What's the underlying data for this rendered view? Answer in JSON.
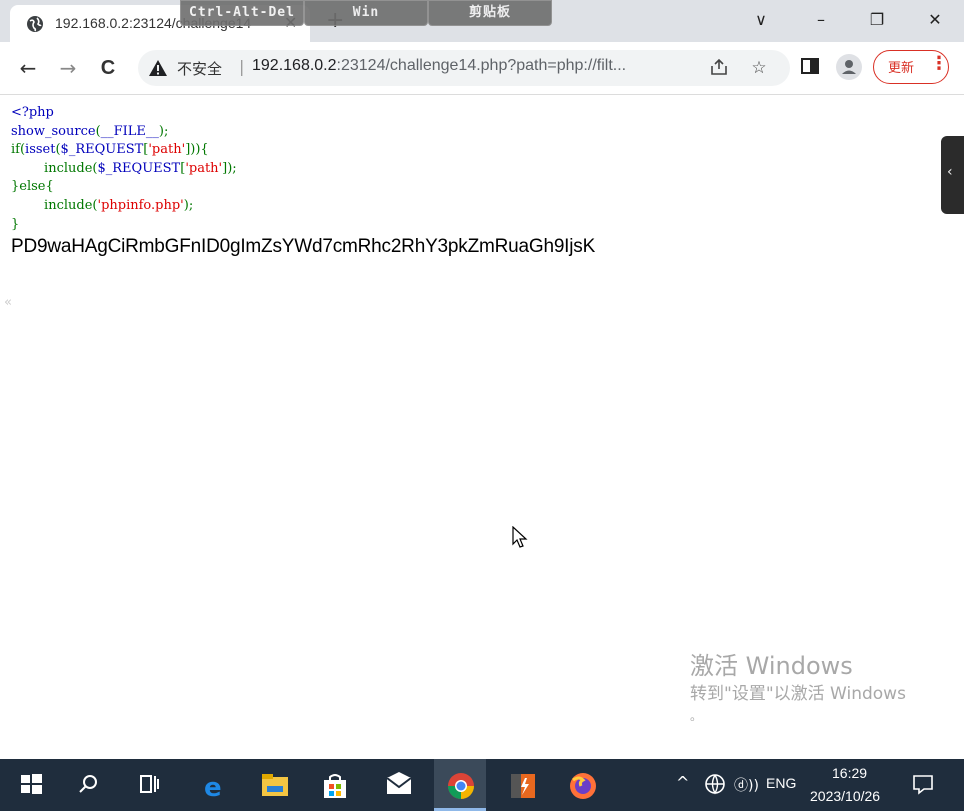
{
  "browser": {
    "tab_title": "192.168.0.2:23124/challenge14",
    "new_tab_symbol": "+",
    "window_controls": {
      "collapse": "∨",
      "minimize": "–",
      "restore": "❐",
      "close": "✕"
    },
    "remote_toolbar": {
      "ctrl_alt_del": "Ctrl-Alt-Del",
      "win": "Win",
      "clipboard": "剪贴板"
    },
    "nav": {
      "back": "←",
      "forward": "→",
      "reload": "C"
    },
    "address": {
      "security_label": "不安全",
      "separator": "|",
      "url_host": "192.168.0.2",
      "url_rest": ":23124/challenge14.php?path=php://filt..."
    },
    "update_button": "更新",
    "menu_symbol": "⋮"
  },
  "page": {
    "source_lines": [
      {
        "parts": [
          {
            "cls": "c-default",
            "text": "<?php"
          }
        ]
      },
      {
        "parts": [
          {
            "cls": "c-default",
            "text": "show_source"
          },
          {
            "cls": "c-keyword",
            "text": "("
          },
          {
            "cls": "c-default",
            "text": "__FILE__"
          },
          {
            "cls": "c-keyword",
            "text": ");"
          }
        ]
      },
      {
        "parts": [
          {
            "cls": "c-keyword",
            "text": "if("
          },
          {
            "cls": "c-default",
            "text": "isset"
          },
          {
            "cls": "c-keyword",
            "text": "("
          },
          {
            "cls": "c-default",
            "text": "$_REQUEST"
          },
          {
            "cls": "c-keyword",
            "text": "["
          },
          {
            "cls": "c-string",
            "text": "'path'"
          },
          {
            "cls": "c-keyword",
            "text": "])){"
          }
        ]
      },
      {
        "parts": [
          {
            "cls": "c-keyword",
            "text": "        include("
          },
          {
            "cls": "c-default",
            "text": "$_REQUEST"
          },
          {
            "cls": "c-keyword",
            "text": "["
          },
          {
            "cls": "c-string",
            "text": "'path'"
          },
          {
            "cls": "c-keyword",
            "text": "]);"
          }
        ]
      },
      {
        "parts": [
          {
            "cls": "c-keyword",
            "text": "}else{"
          }
        ]
      },
      {
        "parts": [
          {
            "cls": "c-keyword",
            "text": "        include("
          },
          {
            "cls": "c-string",
            "text": "'phpinfo.php'"
          },
          {
            "cls": "c-keyword",
            "text": ");"
          }
        ]
      },
      {
        "parts": [
          {
            "cls": "c-keyword",
            "text": "}"
          }
        ]
      }
    ],
    "output_text": "PD9waHAgCiRmbGFnID0gImZsYWd7cmRhc2RhY3pkZmRuaGh9IjsK",
    "watermark": {
      "title": "激活 Windows",
      "subtitle": "转到\"设置\"以激活 Windows",
      "dot": "。"
    }
  },
  "taskbar": {
    "tray_up": "^",
    "volume": "ⓓ))",
    "language": "ENG",
    "time": "16:29",
    "date": "2023/10/26"
  }
}
